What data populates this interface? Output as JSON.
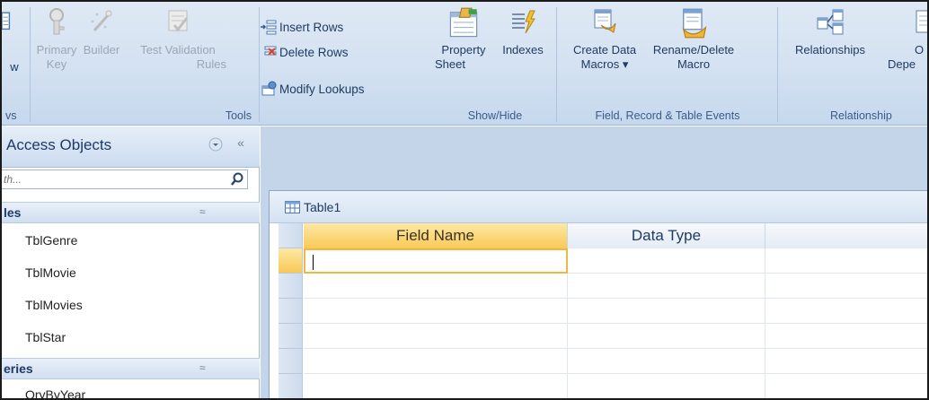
{
  "ribbon": {
    "views_group": {
      "button_partial": "w",
      "label_partial": "vs"
    },
    "tools_group": {
      "primary_key": {
        "line1": "Primary",
        "line2": "Key"
      },
      "builder": {
        "line1": "Builder",
        "line2": ""
      },
      "test_validation_rules": {
        "line1": "Test Validation",
        "line2": "Rules"
      },
      "insert_rows": "Insert Rows",
      "delete_rows": "Delete Rows",
      "modify_lookups": "Modify Lookups",
      "label": "Tools"
    },
    "show_hide_group": {
      "property_sheet": {
        "line1": "Property",
        "line2": "Sheet"
      },
      "indexes": {
        "line1": "Indexes",
        "line2": ""
      },
      "label": "Show/Hide"
    },
    "events_group": {
      "create_data_macros": {
        "line1": "Create Data",
        "line2": "Macros ▾"
      },
      "rename_delete_macro": {
        "line1": "Rename/Delete",
        "line2": "Macro"
      },
      "label": "Field, Record & Table Events"
    },
    "relationships_group": {
      "relationships": {
        "line1": "Relationships",
        "line2": ""
      },
      "object_dependencies": {
        "line1": "O",
        "line2": "Depe"
      },
      "label": "Relationship"
    }
  },
  "nav": {
    "title": "Access Objects",
    "collapse_glyph": "«",
    "search_placeholder": "th...",
    "sections": [
      {
        "title": "les",
        "chevron": "≈",
        "items": [
          "TblGenre",
          "TblMovie",
          "TblMovies",
          "TblStar"
        ]
      },
      {
        "title": "eries",
        "chevron": "≈",
        "items": [
          "QryByYear"
        ]
      }
    ]
  },
  "document": {
    "tab_label": "Table1",
    "columns": [
      "Field Name",
      "Data Type",
      ""
    ],
    "rows": [
      {
        "field_name": "",
        "data_type": ""
      },
      {
        "field_name": "",
        "data_type": ""
      },
      {
        "field_name": "",
        "data_type": ""
      },
      {
        "field_name": "",
        "data_type": ""
      },
      {
        "field_name": "",
        "data_type": ""
      },
      {
        "field_name": "",
        "data_type": ""
      }
    ]
  },
  "colors": {
    "ribbon_bg": "#d3e1f1",
    "group_label": "#3c5b85",
    "active_header": "#f8c957",
    "workspace_bg": "#c4d5ea"
  },
  "icons": [
    "primary-key-icon",
    "builder-icon",
    "test-validation-icon",
    "insert-rows-icon",
    "delete-rows-icon",
    "modify-lookups-icon",
    "property-sheet-icon",
    "indexes-icon",
    "create-data-macros-icon",
    "rename-delete-macro-icon",
    "relationships-icon",
    "object-dependencies-icon",
    "search-icon",
    "table-icon"
  ]
}
